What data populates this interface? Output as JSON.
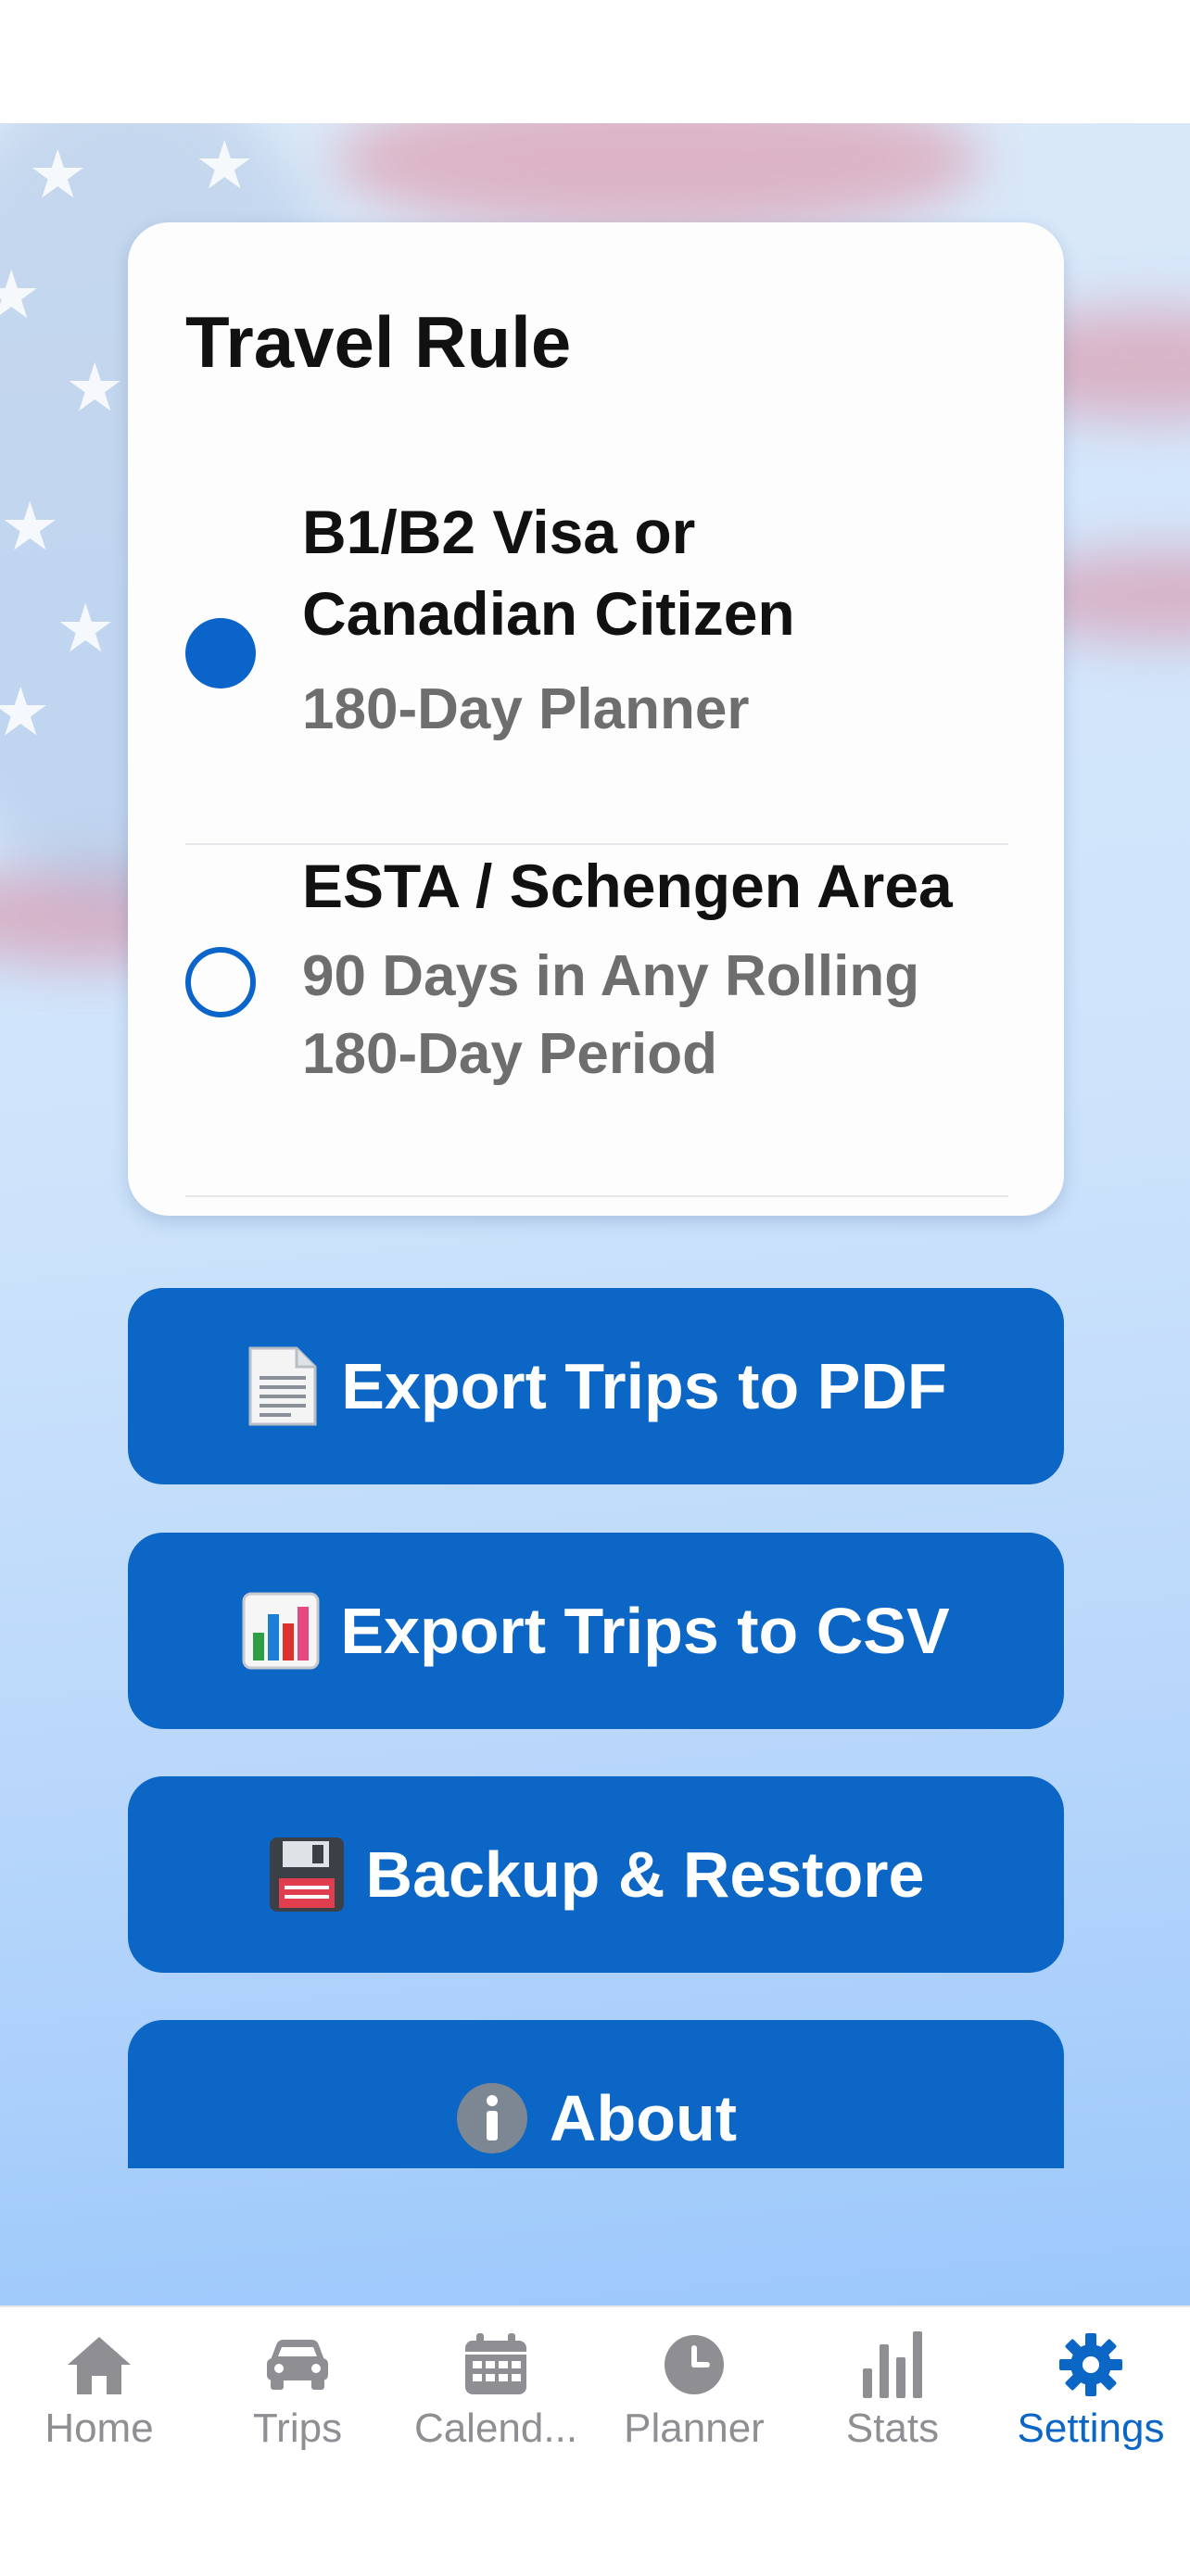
{
  "colors": {
    "accent": "#0b66c6",
    "radio": "#0b64c9",
    "inactive_tab": "#8e8e93"
  },
  "travel_rule": {
    "title": "Travel Rule",
    "options": [
      {
        "title_line1": "B1/B2 Visa or",
        "title_line2": "Canadian Citizen",
        "subtitle": "180-Day Planner",
        "selected": true
      },
      {
        "title": "ESTA / Schengen Area",
        "subtitle_line1": "90 Days in Any Rolling",
        "subtitle_line2": "180-Day Period",
        "selected": false
      }
    ]
  },
  "buttons": {
    "export_pdf": {
      "icon": "document-icon",
      "label": "Export Trips to PDF"
    },
    "export_csv": {
      "icon": "bar-chart-icon",
      "label": "Export Trips to CSV"
    },
    "backup": {
      "icon": "floppy-disk-icon",
      "label": "Backup & Restore"
    },
    "about": {
      "icon": "info-icon",
      "label": "About"
    }
  },
  "tabs": [
    {
      "icon": "home-icon",
      "label": "Home",
      "active": false
    },
    {
      "icon": "car-icon",
      "label": "Trips",
      "active": false
    },
    {
      "icon": "calendar-icon",
      "label": "Calend...",
      "active": false
    },
    {
      "icon": "clock-icon",
      "label": "Planner",
      "active": false
    },
    {
      "icon": "stats-icon",
      "label": "Stats",
      "active": false
    },
    {
      "icon": "gear-icon",
      "label": "Settings",
      "active": true
    }
  ]
}
